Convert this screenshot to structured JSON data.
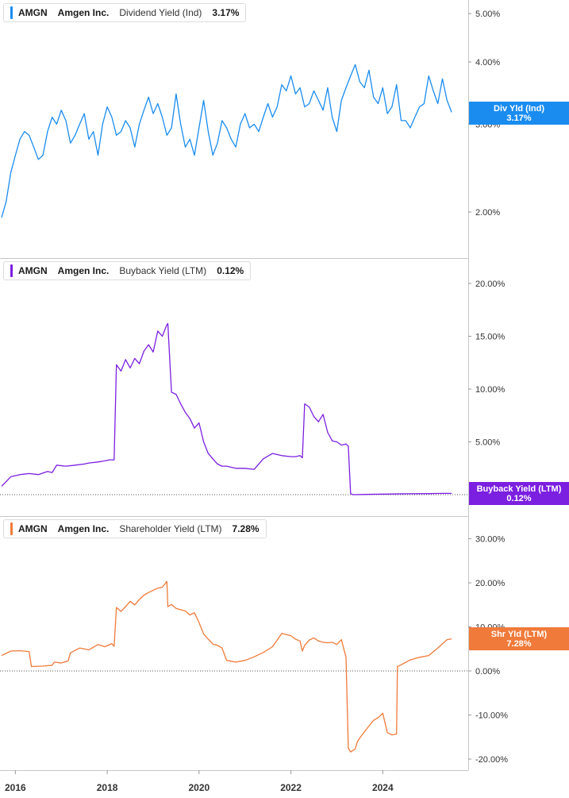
{
  "x_ticks": [
    "2016",
    "2018",
    "2020",
    "2022",
    "2024"
  ],
  "panels": [
    {
      "ticker": "AMGN",
      "company": "Amgen Inc.",
      "metric": "Dividend Yield (Ind)",
      "value": "3.17%",
      "badge_line1": "Div Yld (Ind)",
      "badge_line2": "3.17%",
      "color": "#1a8cf0"
    },
    {
      "ticker": "AMGN",
      "company": "Amgen Inc.",
      "metric": "Buyback Yield (LTM)",
      "value": "0.12%",
      "badge_line1": "Buyback Yield (LTM)",
      "badge_line2": "0.12%",
      "color": "#7b1fe0"
    },
    {
      "ticker": "AMGN",
      "company": "Amgen Inc.",
      "metric": "Shareholder Yield (LTM)",
      "value": "7.28%",
      "badge_line1": "Shr Yld (LTM)",
      "badge_line2": "7.28%",
      "color": "#f07a3a"
    }
  ],
  "chart_data": [
    {
      "type": "line",
      "title": "AMGN Amgen Inc. Dividend Yield (Ind)",
      "y_scale": "log",
      "yticks": [
        "5.00%",
        "4.00%",
        "3.00%",
        "2.00%"
      ],
      "ytick_values": [
        5,
        4,
        3,
        2
      ],
      "series": [
        {
          "name": "Dividend Yield (Ind)",
          "x": [
            2015.7,
            2015.8,
            2015.9,
            2016.0,
            2016.1,
            2016.2,
            2016.3,
            2016.4,
            2016.5,
            2016.6,
            2016.7,
            2016.8,
            2016.9,
            2017.0,
            2017.1,
            2017.2,
            2017.3,
            2017.4,
            2017.5,
            2017.6,
            2017.7,
            2017.8,
            2017.9,
            2018.0,
            2018.1,
            2018.2,
            2018.3,
            2018.4,
            2018.5,
            2018.6,
            2018.7,
            2018.8,
            2018.9,
            2019.0,
            2019.1,
            2019.2,
            2019.3,
            2019.4,
            2019.5,
            2019.6,
            2019.7,
            2019.8,
            2019.9,
            2020.0,
            2020.1,
            2020.2,
            2020.3,
            2020.4,
            2020.5,
            2020.6,
            2020.7,
            2020.8,
            2020.9,
            2021.0,
            2021.1,
            2021.2,
            2021.3,
            2021.4,
            2021.5,
            2021.6,
            2021.7,
            2021.8,
            2021.9,
            2022.0,
            2022.1,
            2022.2,
            2022.3,
            2022.4,
            2022.5,
            2022.6,
            2022.7,
            2022.8,
            2022.9,
            2023.0,
            2023.1,
            2023.2,
            2023.3,
            2023.4,
            2023.5,
            2023.6,
            2023.7,
            2023.8,
            2023.9,
            2024.0,
            2024.1,
            2024.2,
            2024.3,
            2024.4,
            2024.5,
            2024.6,
            2024.7,
            2024.8,
            2024.9,
            2025.0,
            2025.1,
            2025.2,
            2025.3,
            2025.4,
            2025.5
          ],
          "values": [
            1.95,
            2.1,
            2.4,
            2.6,
            2.8,
            2.9,
            2.85,
            2.7,
            2.55,
            2.6,
            2.9,
            3.1,
            3.0,
            3.2,
            3.05,
            2.75,
            2.85,
            3.0,
            3.15,
            2.8,
            2.9,
            2.6,
            3.0,
            3.25,
            3.1,
            2.85,
            2.9,
            3.05,
            2.95,
            2.7,
            3.0,
            3.2,
            3.4,
            3.15,
            3.3,
            3.1,
            2.85,
            2.95,
            3.45,
            3.0,
            2.7,
            2.8,
            2.6,
            2.95,
            3.35,
            2.9,
            2.6,
            2.75,
            3.05,
            2.95,
            2.8,
            2.7,
            3.0,
            3.15,
            2.95,
            3.0,
            2.9,
            3.1,
            3.3,
            3.1,
            3.25,
            3.6,
            3.5,
            3.75,
            3.45,
            3.55,
            3.25,
            3.3,
            3.5,
            3.35,
            3.2,
            3.55,
            3.1,
            2.9,
            3.35,
            3.55,
            3.75,
            3.95,
            3.65,
            3.55,
            3.85,
            3.4,
            3.3,
            3.55,
            3.15,
            3.25,
            3.6,
            3.05,
            3.05,
            2.95,
            3.1,
            3.25,
            3.3,
            3.75,
            3.5,
            3.3,
            3.7,
            3.35,
            3.17
          ]
        }
      ]
    },
    {
      "type": "line",
      "title": "AMGN Amgen Inc. Buyback Yield (LTM)",
      "yticks": [
        "20.00%",
        "15.00%",
        "10.00%",
        "5.00%"
      ],
      "ytick_values": [
        20,
        15,
        10,
        5
      ],
      "zero_line": true,
      "series": [
        {
          "name": "Buyback Yield (LTM)",
          "x": [
            2015.7,
            2015.9,
            2016.1,
            2016.3,
            2016.5,
            2016.7,
            2016.8,
            2016.9,
            2017.1,
            2017.3,
            2017.5,
            2017.6,
            2017.8,
            2017.95,
            2018.05,
            2018.15,
            2018.2,
            2018.3,
            2018.4,
            2018.5,
            2018.6,
            2018.7,
            2018.8,
            2018.9,
            2019.0,
            2019.1,
            2019.2,
            2019.3,
            2019.32,
            2019.4,
            2019.5,
            2019.6,
            2019.7,
            2019.8,
            2019.9,
            2020.0,
            2020.1,
            2020.2,
            2020.3,
            2020.4,
            2020.5,
            2020.6,
            2020.8,
            2021.0,
            2021.2,
            2021.4,
            2021.6,
            2021.8,
            2022.0,
            2022.1,
            2022.2,
            2022.25,
            2022.3,
            2022.4,
            2022.5,
            2022.6,
            2022.7,
            2022.8,
            2022.9,
            2023.0,
            2023.1,
            2023.2,
            2023.25,
            2023.3,
            2023.35,
            2023.6,
            2024.0,
            2024.5,
            2025.0,
            2025.3,
            2025.5
          ],
          "values": [
            0.8,
            1.7,
            1.9,
            2.0,
            1.9,
            2.2,
            2.1,
            2.8,
            2.7,
            2.8,
            2.9,
            3.0,
            3.1,
            3.2,
            3.3,
            3.3,
            12.3,
            11.7,
            12.8,
            12.0,
            12.9,
            12.4,
            13.6,
            14.2,
            13.5,
            15.5,
            15.0,
            16.1,
            16.2,
            9.7,
            9.5,
            8.6,
            7.8,
            7.2,
            6.3,
            6.8,
            5.0,
            3.9,
            3.4,
            2.9,
            2.7,
            2.7,
            2.5,
            2.5,
            2.4,
            3.4,
            3.9,
            3.7,
            3.6,
            3.6,
            3.7,
            3.5,
            8.6,
            8.3,
            7.4,
            6.9,
            7.6,
            5.9,
            5.1,
            5.0,
            4.7,
            4.8,
            4.6,
            0.1,
            0.0,
            0.02,
            0.05,
            0.08,
            0.1,
            0.12,
            0.12
          ]
        }
      ]
    },
    {
      "type": "line",
      "title": "AMGN Amgen Inc. Shareholder Yield (LTM)",
      "yticks": [
        "30.00%",
        "20.00%",
        "10.00%",
        "0.00%",
        "-10.00%",
        "-20.00%"
      ],
      "ytick_values": [
        30,
        20,
        10,
        0,
        -10,
        -20
      ],
      "zero_line": true,
      "series": [
        {
          "name": "Shareholder Yield (LTM)",
          "x": [
            2015.7,
            2015.9,
            2016.1,
            2016.3,
            2016.35,
            2016.6,
            2016.8,
            2016.85,
            2017.0,
            2017.15,
            2017.2,
            2017.4,
            2017.6,
            2017.8,
            2017.95,
            2018.1,
            2018.15,
            2018.2,
            2018.3,
            2018.4,
            2018.5,
            2018.6,
            2018.7,
            2018.8,
            2018.9,
            2019.0,
            2019.1,
            2019.2,
            2019.3,
            2019.32,
            2019.4,
            2019.5,
            2019.6,
            2019.7,
            2019.8,
            2019.9,
            2020.0,
            2020.1,
            2020.2,
            2020.3,
            2020.4,
            2020.5,
            2020.6,
            2020.8,
            2021.0,
            2021.2,
            2021.4,
            2021.6,
            2021.8,
            2022.0,
            2022.1,
            2022.2,
            2022.25,
            2022.3,
            2022.4,
            2022.5,
            2022.6,
            2022.7,
            2022.8,
            2022.9,
            2023.0,
            2023.1,
            2023.2,
            2023.25,
            2023.3,
            2023.4,
            2023.45,
            2023.5,
            2023.6,
            2023.7,
            2023.8,
            2023.9,
            2024.0,
            2024.1,
            2024.2,
            2024.3,
            2024.32,
            2024.4,
            2024.6,
            2024.8,
            2025.0,
            2025.2,
            2025.4,
            2025.5
          ],
          "values": [
            3.5,
            4.5,
            4.6,
            4.4,
            1.0,
            1.1,
            1.3,
            2.0,
            1.8,
            2.3,
            4.1,
            5.2,
            4.8,
            6.0,
            5.5,
            6.2,
            5.6,
            14.4,
            13.5,
            14.6,
            15.8,
            15.0,
            16.2,
            17.2,
            17.8,
            18.3,
            18.8,
            19.0,
            20.3,
            14.6,
            15.1,
            14.2,
            13.9,
            13.6,
            12.7,
            13.2,
            11.0,
            8.4,
            7.2,
            6.1,
            5.8,
            5.2,
            2.4,
            2.0,
            2.4,
            3.2,
            4.2,
            5.5,
            8.5,
            8.0,
            7.2,
            6.8,
            4.5,
            5.8,
            7.0,
            7.5,
            6.8,
            6.5,
            6.4,
            6.5,
            6.0,
            7.1,
            3.1,
            -17.5,
            -18.4,
            -17.7,
            -16.0,
            -15.2,
            -13.8,
            -12.5,
            -11.2,
            -10.6,
            -9.6,
            -14.0,
            -14.5,
            -14.3,
            1.0,
            1.4,
            2.5,
            3.1,
            3.5,
            5.2,
            7.1,
            7.28
          ]
        }
      ]
    }
  ]
}
